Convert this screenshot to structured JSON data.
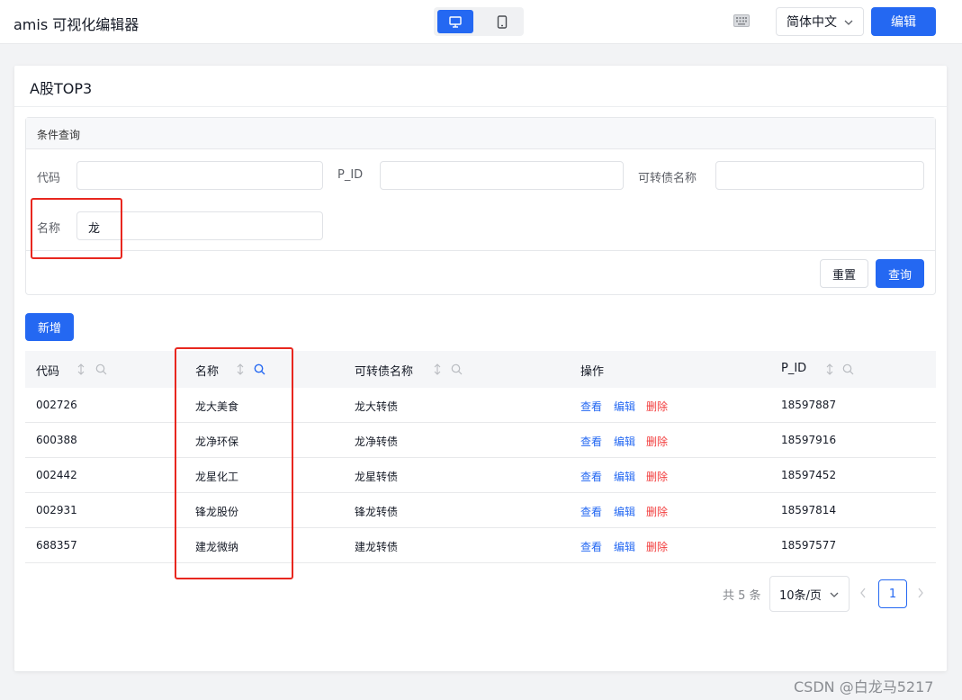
{
  "header": {
    "title": "amis 可视化编辑器",
    "lang": "简体中文",
    "edit_label": "编辑"
  },
  "page": {
    "title": "A股TOP3"
  },
  "filter": {
    "title": "条件查询",
    "code_label": "代码",
    "code_value": "",
    "pid_label": "P_ID",
    "pid_value": "",
    "bond_label": "可转债名称",
    "bond_value": "",
    "name_label": "名称",
    "name_value": "龙",
    "reset_label": "重置",
    "query_label": "查询"
  },
  "toolbar": {
    "add_label": "新增"
  },
  "table": {
    "columns": [
      "代码",
      "名称",
      "可转债名称",
      "操作",
      "P_ID"
    ],
    "rows": [
      {
        "code": "002726",
        "name": "龙大美食",
        "bond": "龙大转债",
        "pid": "18597887"
      },
      {
        "code": "600388",
        "name": "龙净环保",
        "bond": "龙净转债",
        "pid": "18597916"
      },
      {
        "code": "002442",
        "name": "龙星化工",
        "bond": "龙星转债",
        "pid": "18597452"
      },
      {
        "code": "002931",
        "name": "锋龙股份",
        "bond": "锋龙转债",
        "pid": "18597814"
      },
      {
        "code": "688357",
        "name": "建龙微纳",
        "bond": "建龙转债",
        "pid": "18597577"
      }
    ],
    "actions": {
      "view": "查看",
      "edit": "编辑",
      "delete": "删除"
    }
  },
  "pagination": {
    "total": "共 5 条",
    "per_page": "10条/页",
    "current": "1"
  },
  "watermark": "CSDN @白龙马5217",
  "colors": {
    "primary": "#2468f2",
    "danger": "#f23d3d",
    "highlight": "#e8271f"
  }
}
